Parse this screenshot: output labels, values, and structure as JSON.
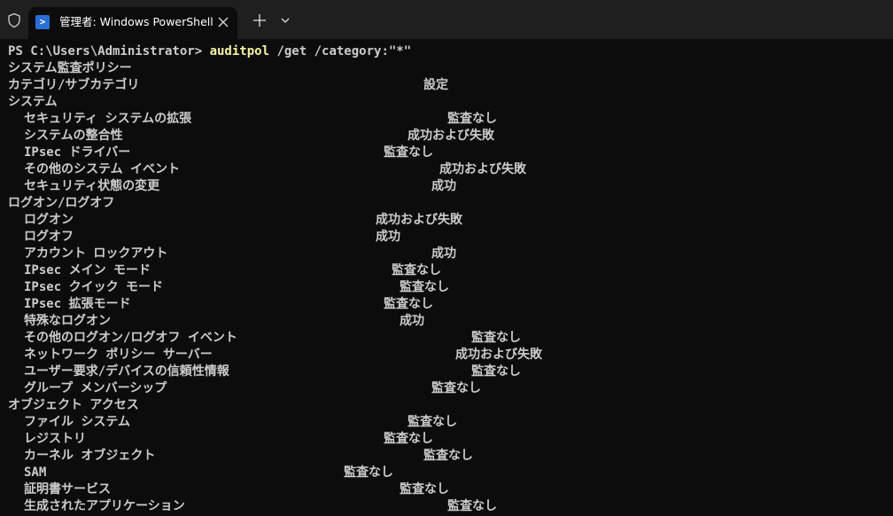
{
  "window": {
    "tab_title": "管理者: Windows PowerShell",
    "tab_icon": "powershell-icon",
    "icons": [
      "shield-icon",
      "powershell-icon",
      "close-icon",
      "plus-icon",
      "chevron-down-icon"
    ]
  },
  "colors": {
    "titlebar": "#1f1f1f",
    "terminal_bg": "#0c0c0c",
    "text": "#cccccc",
    "command": "#f9f1a5"
  },
  "terminal": {
    "prompt": "PS C:\\Users\\Administrator> ",
    "command": "auditpol",
    "args": " /get /category:\"*\"",
    "heading": "システム監査ポリシー",
    "column_header": {
      "label": "カテゴリ/サブカテゴリ",
      "setting": "設定"
    },
    "categories": [
      {
        "name": "システム",
        "items": [
          {
            "label": "セキュリティ システムの拡張",
            "value": "監査なし"
          },
          {
            "label": "システムの整合性",
            "value": "成功および失敗"
          },
          {
            "label": "IPsec ドライバー",
            "value": "監査なし"
          },
          {
            "label": "その他のシステム イベント",
            "value": "成功および失敗"
          },
          {
            "label": "セキュリティ状態の変更",
            "value": "成功"
          }
        ]
      },
      {
        "name": "ログオン/ログオフ",
        "items": [
          {
            "label": "ログオン",
            "value": "成功および失敗"
          },
          {
            "label": "ログオフ",
            "value": "成功"
          },
          {
            "label": "アカウント ロックアウト",
            "value": "成功"
          },
          {
            "label": "IPsec メイン モード",
            "value": "監査なし"
          },
          {
            "label": "IPsec クイック モード",
            "value": "監査なし"
          },
          {
            "label": "IPsec 拡張モード",
            "value": "監査なし"
          },
          {
            "label": "特殊なログオン",
            "value": "成功"
          },
          {
            "label": "その他のログオン/ログオフ イベント",
            "value": "監査なし"
          },
          {
            "label": "ネットワーク ポリシー サーバー",
            "value": "成功および失敗"
          },
          {
            "label": "ユーザー要求/デバイスの信頼性情報",
            "value": "監査なし"
          },
          {
            "label": "グループ メンバーシップ",
            "value": "監査なし"
          }
        ]
      },
      {
        "name": "オブジェクト アクセス",
        "items": [
          {
            "label": "ファイル システム",
            "value": "監査なし"
          },
          {
            "label": "レジストリ",
            "value": "監査なし"
          },
          {
            "label": "カーネル オブジェクト",
            "value": "監査なし"
          },
          {
            "label": "SAM",
            "value": "監査なし"
          },
          {
            "label": "証明書サービス",
            "value": "監査なし"
          },
          {
            "label": "生成されたアプリケーション",
            "value": "監査なし"
          }
        ]
      }
    ]
  }
}
